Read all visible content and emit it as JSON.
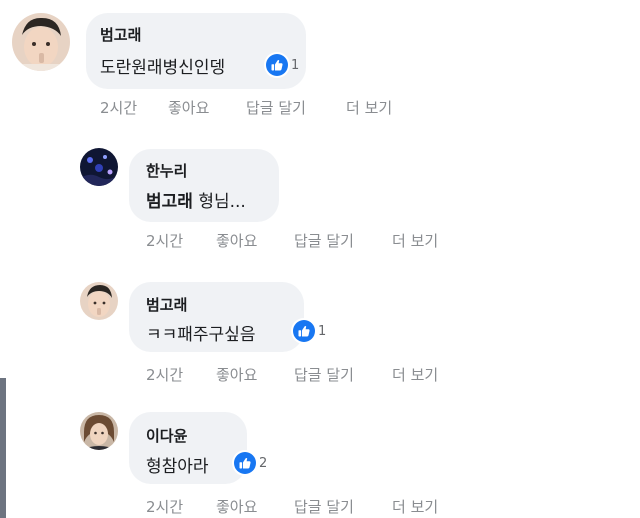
{
  "colors": {
    "bubble": "#f0f2f5",
    "text": "#1c1e21",
    "meta": "#8a8d91",
    "like": "#1877f2"
  },
  "comments": [
    {
      "author": "범고래",
      "text": "도란원래병신인뎅",
      "reaction_count": "1",
      "time": "2시간",
      "like_label": "좋아요",
      "reply_label": "답글 달기",
      "more_label": "더 보기"
    },
    {
      "author": "한누리",
      "mention": "범고래",
      "text": "형님...",
      "time": "2시간",
      "like_label": "좋아요",
      "reply_label": "답글 달기",
      "more_label": "더 보기"
    },
    {
      "author": "범고래",
      "text": "ㅋㅋ패주구싶음",
      "reaction_count": "1",
      "time": "2시간",
      "like_label": "좋아요",
      "reply_label": "답글 달기",
      "more_label": "더 보기"
    },
    {
      "author": "이다윤",
      "text": "형참아라",
      "reaction_count": "2",
      "time": "2시간",
      "like_label": "좋아요",
      "reply_label": "답글 달기",
      "more_label": "더 보기"
    }
  ],
  "icons": {
    "reaction": "thumbs-up-icon"
  }
}
